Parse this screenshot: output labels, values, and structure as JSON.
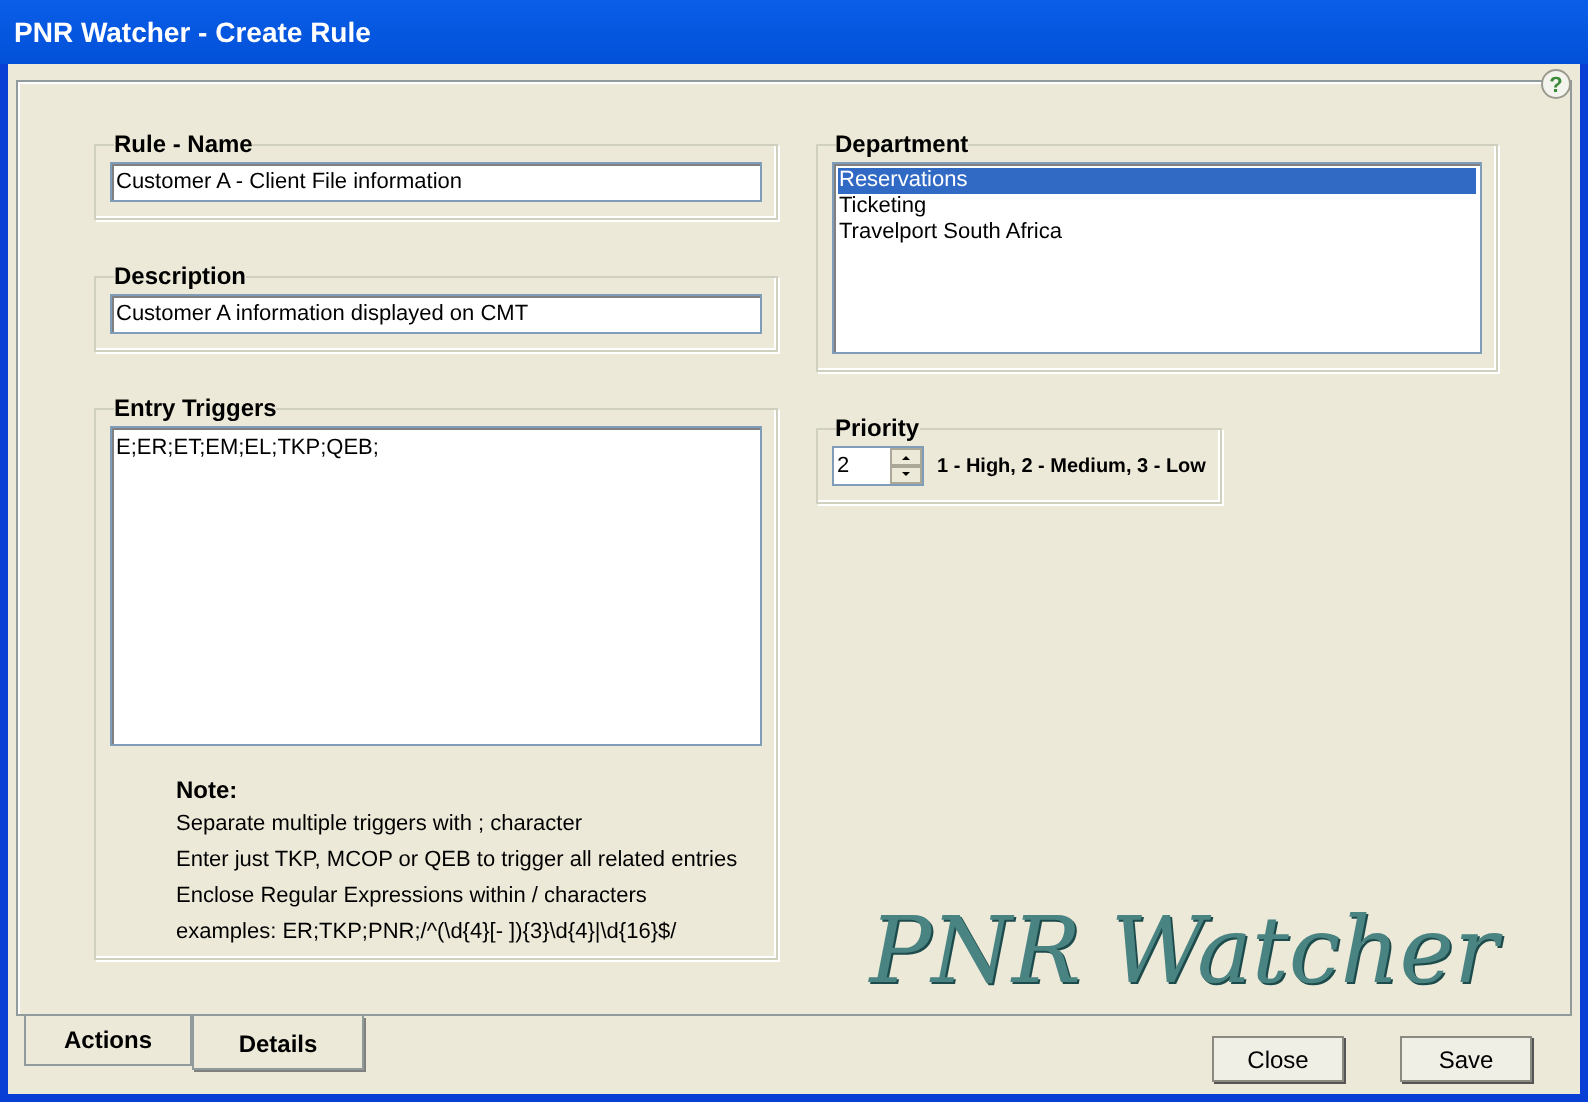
{
  "window": {
    "title": "PNR Watcher - Create Rule",
    "help_glyph": "?"
  },
  "rule_name": {
    "label": "Rule - Name",
    "value": "Customer A - Client File information"
  },
  "description": {
    "label": "Description",
    "value": "Customer A information displayed on CMT"
  },
  "entry_triggers": {
    "label": "Entry Triggers",
    "value": "E;ER;ET;EM;EL;TKP;QEB;",
    "note_title": "Note:",
    "note_lines": [
      "Separate multiple triggers with ; character",
      "Enter just TKP, MCOP or QEB  to trigger all related entries",
      "Enclose Regular Expressions within / characters",
      "examples: ER;TKP;PNR;/^(\\d{4}[- ]){3}\\d{4}|\\d{16}$/"
    ]
  },
  "department": {
    "label": "Department",
    "items": [
      {
        "label": "Reservations",
        "selected": true
      },
      {
        "label": "Ticketing",
        "selected": false
      },
      {
        "label": "Travelport South Africa",
        "selected": false
      }
    ]
  },
  "priority": {
    "label": "Priority",
    "value": "2",
    "hint": "1 - High, 2 - Medium, 3 - Low"
  },
  "logo": {
    "text": "PNR Watcher"
  },
  "tabs": [
    {
      "label": "Actions",
      "selected": false
    },
    {
      "label": "Details",
      "selected": true
    }
  ],
  "buttons": [
    "Close",
    "Save"
  ]
}
